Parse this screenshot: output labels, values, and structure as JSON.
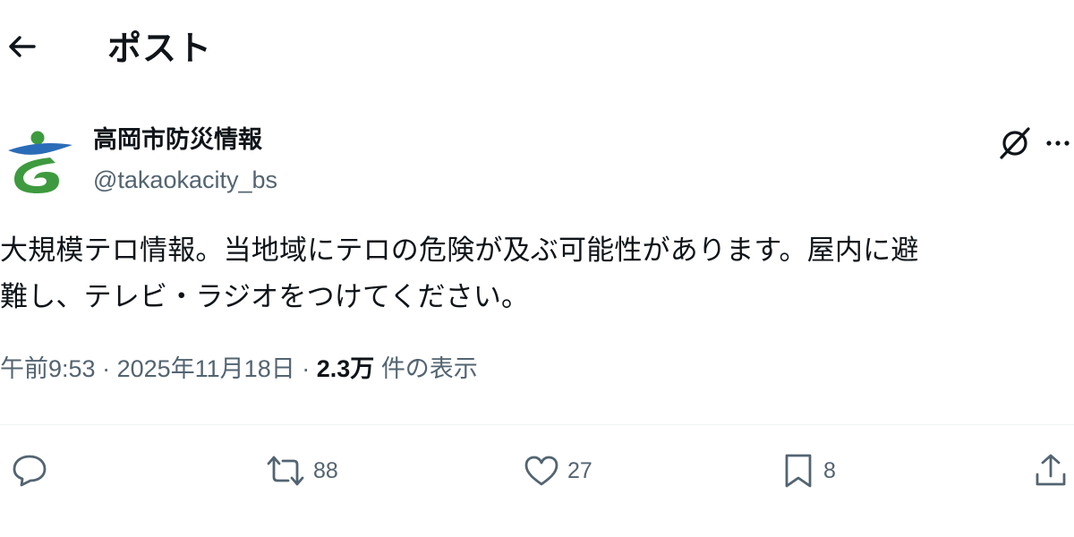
{
  "header": {
    "back_icon": "arrow-left-icon",
    "title": "ポスト"
  },
  "author": {
    "display_name": "高岡市防災情報",
    "handle": "@takaokacity_bs",
    "avatar_colors": {
      "blue": "#2b6cb8",
      "green": "#3e9a3e"
    }
  },
  "post": {
    "text": "大規模テロ情報。当地域にテロの危険が及ぶ可能性があります。屋内に避\n難し、テレビ・ラジオをつけてください。",
    "time": "午前9:53",
    "date": "2025年11月18日",
    "views_count": "2.3万",
    "views_label": "件の表示",
    "separator": "·"
  },
  "actions": {
    "reply": {
      "icon": "reply-icon",
      "count": ""
    },
    "repost": {
      "icon": "repost-icon",
      "count": "88"
    },
    "like": {
      "icon": "heart-icon",
      "count": "27"
    },
    "bookmark": {
      "icon": "bookmark-icon",
      "count": "8"
    },
    "share": {
      "icon": "share-icon"
    }
  },
  "colors": {
    "text_primary": "#0f1419",
    "text_secondary": "#536471",
    "divider": "#eff3f4"
  }
}
